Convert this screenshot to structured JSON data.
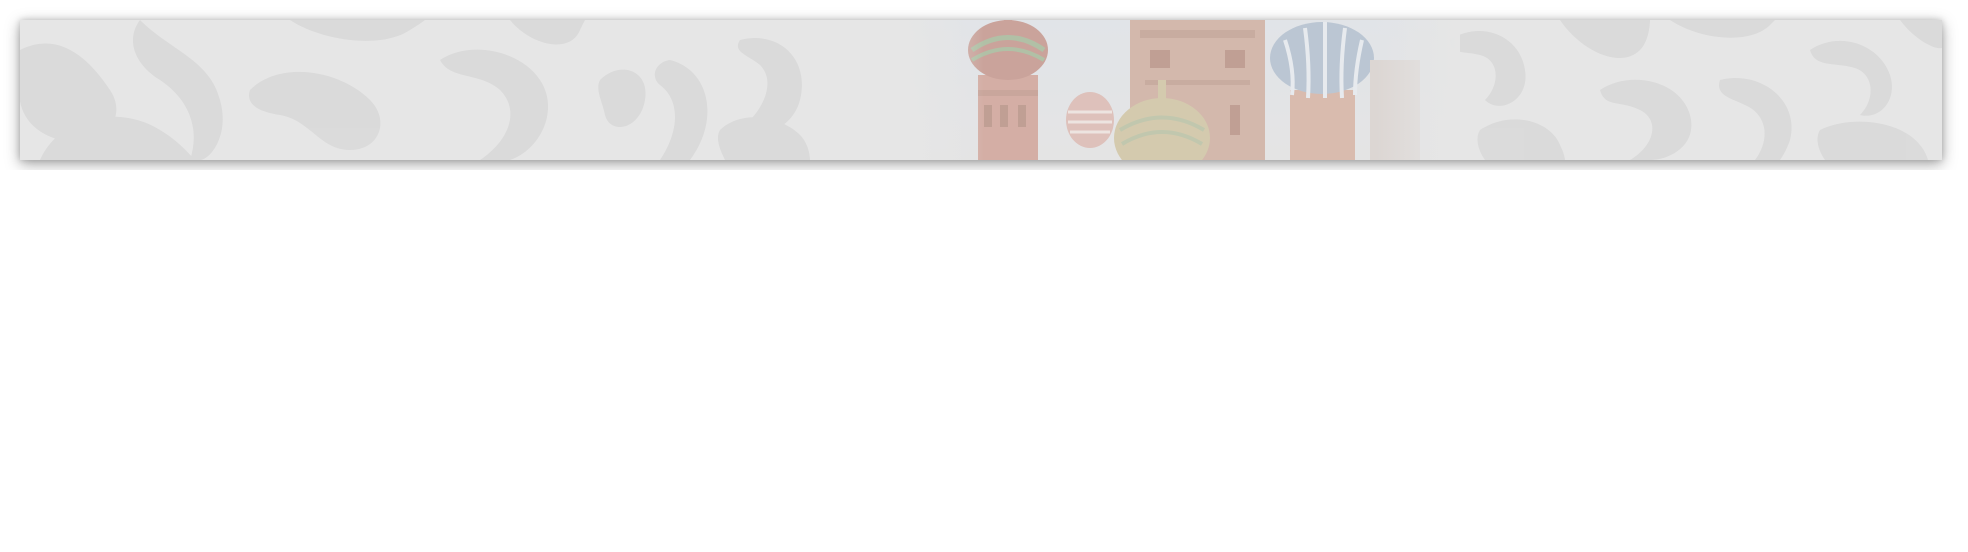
{
  "banner": {
    "image": "header-banner-image",
    "background_color": "#e6e6e6",
    "ornament_color": "#d8d8d8",
    "subject": "cathedral-domes-image"
  },
  "colors": {
    "dome_red": "#c98a7a",
    "dome_green": "#9fae86",
    "dome_blue": "#9fb2c8",
    "dome_gold": "#c9b98a",
    "tower_brick": "#c79b86"
  }
}
